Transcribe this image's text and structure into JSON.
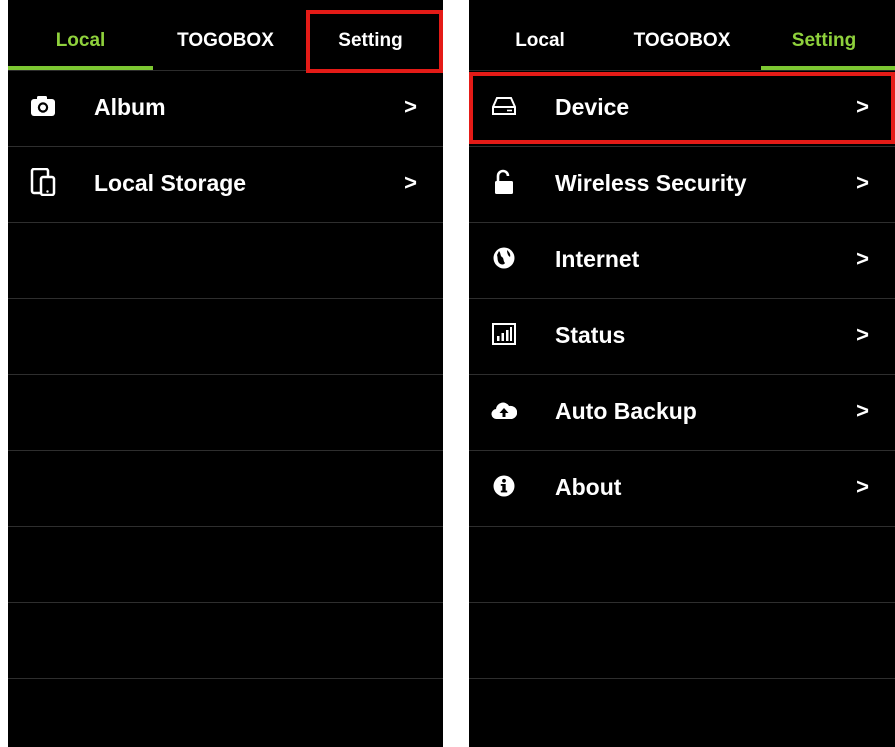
{
  "left_screen": {
    "tabs": [
      {
        "label": "Local",
        "active": true
      },
      {
        "label": "TOGOBOX",
        "active": false
      },
      {
        "label": "Setting",
        "active": false
      }
    ],
    "items": [
      {
        "label": "Album",
        "icon": "camera-icon",
        "chevron": ">"
      },
      {
        "label": "Local Storage",
        "icon": "devices-icon",
        "chevron": ">"
      }
    ]
  },
  "right_screen": {
    "tabs": [
      {
        "label": "Local",
        "active": false
      },
      {
        "label": "TOGOBOX",
        "active": false
      },
      {
        "label": "Setting",
        "active": true
      }
    ],
    "items": [
      {
        "label": "Device",
        "icon": "hard-drive-icon",
        "chevron": ">"
      },
      {
        "label": "Wireless Security",
        "icon": "unlock-icon",
        "chevron": ">"
      },
      {
        "label": "Internet",
        "icon": "globe-icon",
        "chevron": ">"
      },
      {
        "label": "Status",
        "icon": "bar-chart-icon",
        "chevron": ">"
      },
      {
        "label": "Auto Backup",
        "icon": "cloud-upload-icon",
        "chevron": ">"
      },
      {
        "label": "About",
        "icon": "info-icon",
        "chevron": ">"
      }
    ]
  },
  "colors": {
    "background": "#000000",
    "accent_green": "#7dc832",
    "highlight_red": "#e41b17",
    "text": "#ffffff",
    "divider": "#2e2e2e"
  }
}
